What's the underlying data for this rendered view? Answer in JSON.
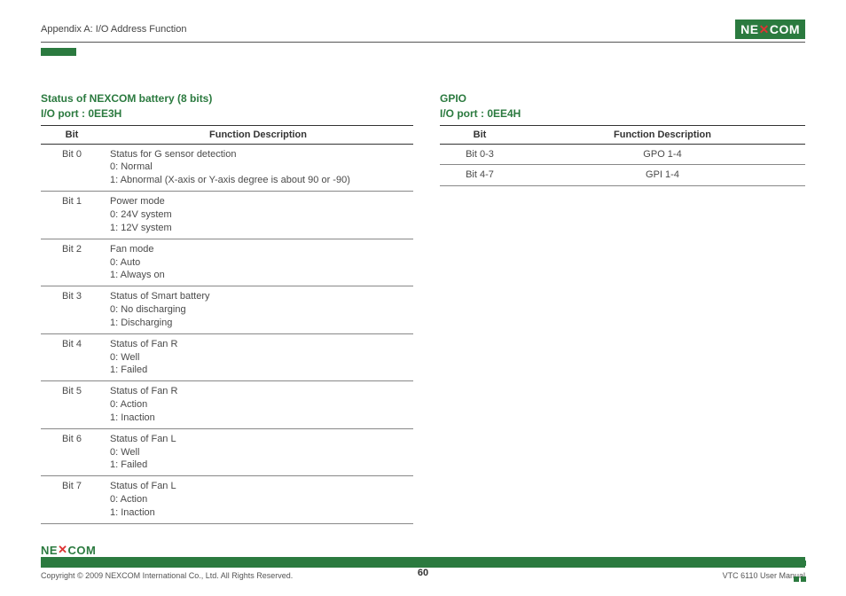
{
  "header": {
    "appendix": "Appendix A: I/O Address Function",
    "logo_text": "NE COM",
    "logo_brand": "NEXCOM"
  },
  "left": {
    "title_line1": "Status of NEXCOM battery (8 bits)",
    "title_line2": "I/O port : 0EE3H",
    "col_bit": "Bit",
    "col_desc": "Function Description",
    "rows": [
      {
        "bit": "Bit 0",
        "desc": "Status for G sensor detection\n0: Normal\n1: Abnormal (X-axis or Y-axis degree is about 90 or -90)"
      },
      {
        "bit": "Bit 1",
        "desc": "Power mode\n0: 24V system\n1: 12V system"
      },
      {
        "bit": "Bit 2",
        "desc": "Fan mode\n0: Auto\n1: Always on"
      },
      {
        "bit": "Bit 3",
        "desc": "Status of Smart battery\n0: No discharging\n1: Discharging"
      },
      {
        "bit": "Bit 4",
        "desc": "Status of Fan R\n0: Well\n1: Failed"
      },
      {
        "bit": "Bit 5",
        "desc": "Status of Fan R\n0: Action\n1: Inaction"
      },
      {
        "bit": "Bit 6",
        "desc": "Status of Fan L\n0: Well\n1: Failed"
      },
      {
        "bit": "Bit 7",
        "desc": "Status of Fan L\n0: Action\n1: Inaction"
      }
    ]
  },
  "right": {
    "title_line1": "GPIO",
    "title_line2": "I/O port : 0EE4H",
    "col_bit": "Bit",
    "col_desc": "Function Description",
    "rows": [
      {
        "bit": "Bit 0-3",
        "desc": "GPO 1-4"
      },
      {
        "bit": "Bit 4-7",
        "desc": "GPI 1-4"
      }
    ]
  },
  "footer": {
    "logo": "NEXCOM",
    "copyright": "Copyright © 2009 NEXCOM International Co., Ltd. All Rights Reserved.",
    "page": "60",
    "manual": "VTC 6110 User Manual"
  }
}
